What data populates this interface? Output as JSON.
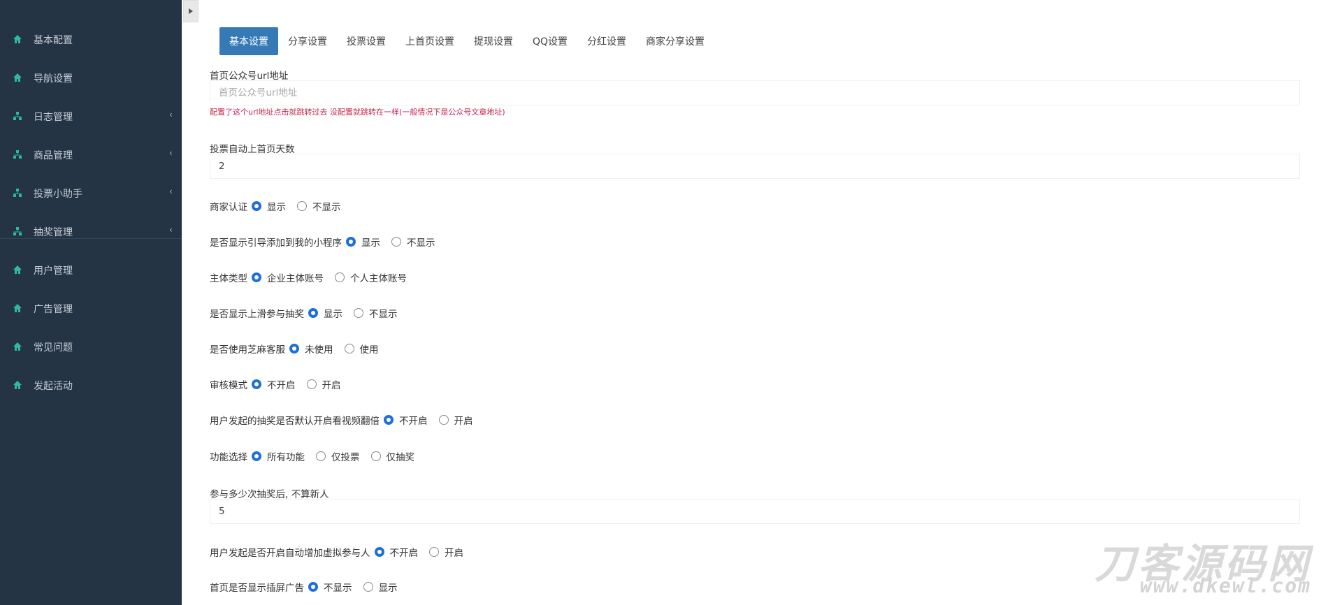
{
  "sidebar": {
    "items": [
      {
        "label": "基本配置",
        "icon": "home-icon",
        "has_children": false
      },
      {
        "label": "导航设置",
        "icon": "home-icon",
        "has_children": false
      },
      {
        "label": "日志管理",
        "icon": "sitemap-icon",
        "has_children": true
      },
      {
        "label": "商品管理",
        "icon": "sitemap-icon",
        "has_children": true
      },
      {
        "label": "投票小助手",
        "icon": "sitemap-icon",
        "has_children": true
      },
      {
        "label": "抽奖管理",
        "icon": "sitemap-icon",
        "has_children": true
      },
      {
        "label": "用户管理",
        "icon": "home-icon",
        "has_children": false
      },
      {
        "label": "广告管理",
        "icon": "home-icon",
        "has_children": false
      },
      {
        "label": "常见问题",
        "icon": "home-icon",
        "has_children": false
      },
      {
        "label": "发起活动",
        "icon": "home-icon",
        "has_children": false
      }
    ],
    "icon_color": "#2fb9a5",
    "chevron": "‹"
  },
  "tabs": [
    {
      "label": "基本设置",
      "active": true
    },
    {
      "label": "分享设置",
      "active": false
    },
    {
      "label": "投票设置",
      "active": false
    },
    {
      "label": "上首页设置",
      "active": false
    },
    {
      "label": "提现设置",
      "active": false
    },
    {
      "label": "QQ设置",
      "active": false
    },
    {
      "label": "分红设置",
      "active": false
    },
    {
      "label": "商家分享设置",
      "active": false
    }
  ],
  "form": {
    "url_label": "首页公众号url地址",
    "url_placeholder": "首页公众号url地址",
    "url_value": "",
    "url_hint": "配置了这个url地址点击就跳转过去 没配置就跳转在一样(一般情况下是公众号文章地址)",
    "days_label": "投票自动上首页天数",
    "days_value": "2",
    "count_label": "参与多少次抽奖后, 不算新人",
    "count_value": "5",
    "radios": [
      {
        "question": "商家认证",
        "options": [
          "显示",
          "不显示"
        ],
        "selected": 0
      },
      {
        "question": "是否显示引导添加到我的小程序",
        "options": [
          "显示",
          "不显示"
        ],
        "selected": 0
      },
      {
        "question": "主体类型",
        "options": [
          "企业主体账号",
          "个人主体账号"
        ],
        "selected": 0
      },
      {
        "question": "是否显示上滑参与抽奖",
        "options": [
          "显示",
          "不显示"
        ],
        "selected": 0
      },
      {
        "question": "是否使用芝麻客服",
        "options": [
          "未使用",
          "使用"
        ],
        "selected": 0
      },
      {
        "question": "审核模式",
        "options": [
          "不开启",
          "开启"
        ],
        "selected": 0
      },
      {
        "question": "用户发起的抽奖是否默认开启看视频翻倍",
        "options": [
          "不开启",
          "开启"
        ],
        "selected": 0
      },
      {
        "question": "功能选择",
        "options": [
          "所有功能",
          "仅投票",
          "仅抽奖"
        ],
        "selected": 0
      },
      {
        "question": "用户发起是否开启自动增加虚拟参与人",
        "options": [
          "不开启",
          "开启"
        ],
        "selected": 0
      },
      {
        "question": "首页是否显示插屏广告",
        "options": [
          "不显示",
          "显示"
        ],
        "selected": 0
      }
    ]
  },
  "watermark": {
    "title": "刀客源码网",
    "url": "www.dkewl.com"
  },
  "colors": {
    "sidebar_bg": "#253445",
    "tab_active": "#357ab5",
    "radio_checked": "#1e6fd9",
    "hint_text": "#c7254e"
  }
}
